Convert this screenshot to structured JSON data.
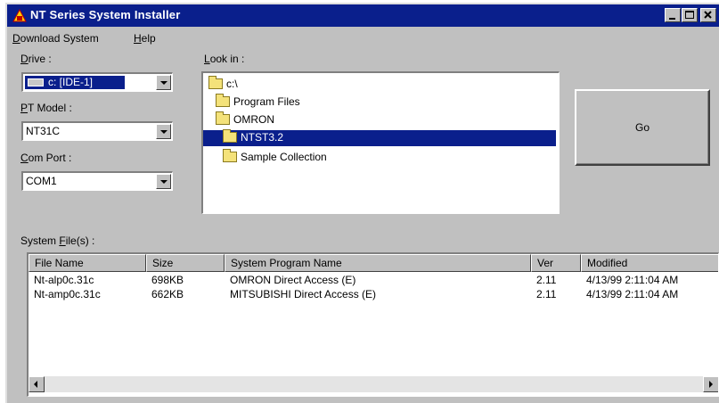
{
  "window": {
    "title": "NT Series System Installer",
    "title_icon": "installer-icon",
    "colors": {
      "titlebar": "#0a1f8c",
      "face": "#c0c0c0",
      "selection": "#0a1f8c"
    }
  },
  "menu": {
    "items": [
      {
        "accel": "D",
        "rest": "ownload System"
      },
      {
        "accel": "H",
        "rest": "elp"
      }
    ]
  },
  "drive": {
    "label_accel": "D",
    "label_rest": "rive :",
    "value": "c: [IDE-1]",
    "icon": "hard-drive-icon"
  },
  "pt_model": {
    "label_accel": "P",
    "label_rest": "T Model :",
    "value": "NT31C"
  },
  "com_port": {
    "label_accel": "C",
    "label_rest": "om Port :",
    "value": "COM1"
  },
  "look_in": {
    "label_accel": "L",
    "label_rest": "ook in :",
    "folders": [
      {
        "name": "c:\\",
        "selected": false,
        "icon": "open-folder-icon"
      },
      {
        "name": "Program Files",
        "selected": false,
        "icon": "open-folder-icon"
      },
      {
        "name": "OMRON",
        "selected": false,
        "icon": "open-folder-icon"
      },
      {
        "name": "NTST3.2",
        "selected": true,
        "icon": "open-folder-icon"
      },
      {
        "name": "Sample Collection",
        "selected": false,
        "icon": "folder-icon"
      }
    ]
  },
  "go_button": {
    "label": "Go"
  },
  "system_files": {
    "label_pre": "System ",
    "label_accel": "F",
    "label_post": "ile(s) :",
    "columns": [
      "File Name",
      "Size",
      "System Program Name",
      "Ver",
      "Modified"
    ],
    "rows": [
      [
        "Nt-alp0c.31c",
        "698KB",
        "OMRON Direct Access (E)",
        "2.11",
        "4/13/99 2:11:04 AM"
      ],
      [
        "Nt-amp0c.31c",
        "662KB",
        "MITSUBISHI Direct Access (E)",
        "2.11",
        "4/13/99 2:11:04 AM"
      ]
    ]
  }
}
